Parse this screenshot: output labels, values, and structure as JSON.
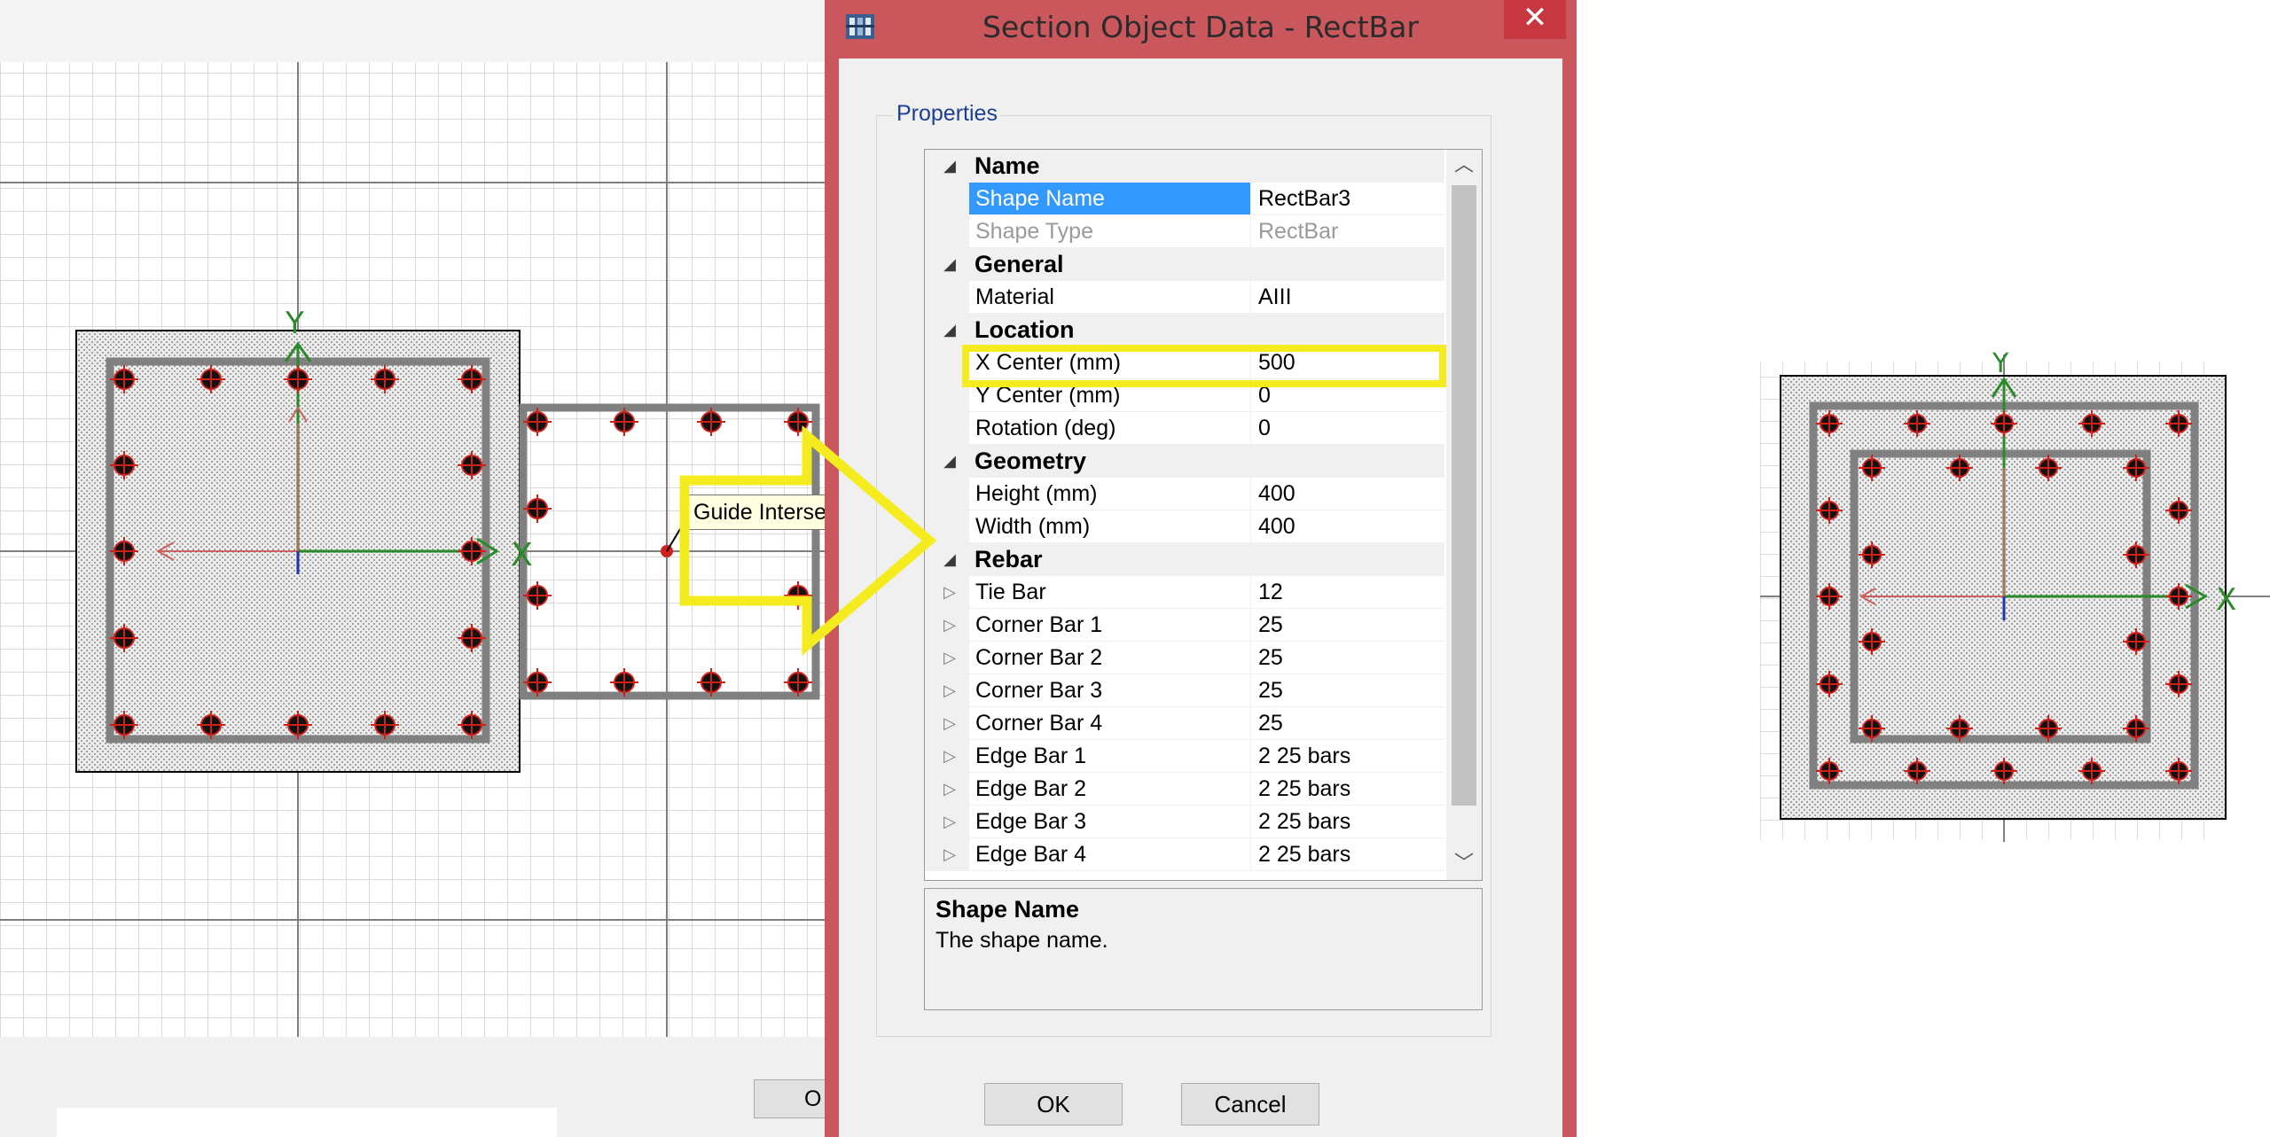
{
  "dialog": {
    "title": "Section Object Data - RectBar",
    "close_label": "✕",
    "group_label": "Properties",
    "categories": {
      "name": "Name",
      "general": "General",
      "location": "Location",
      "geometry": "Geometry",
      "rebar": "Rebar"
    },
    "properties": {
      "shape_name": {
        "label": "Shape Name",
        "value": "RectBar3"
      },
      "shape_type": {
        "label": "Shape Type",
        "value": "RectBar"
      },
      "material": {
        "label": "Material",
        "value": "AIII"
      },
      "x_center": {
        "label": "X Center (mm)",
        "value": "500"
      },
      "y_center": {
        "label": "Y Center (mm)",
        "value": "0"
      },
      "rotation": {
        "label": "Rotation (deg)",
        "value": "0"
      },
      "height": {
        "label": "Height (mm)",
        "value": "400"
      },
      "width": {
        "label": "Width (mm)",
        "value": "400"
      },
      "tie_bar": {
        "label": "Tie Bar",
        "value": "12"
      },
      "corner_bar_1": {
        "label": "Corner Bar 1",
        "value": "25"
      },
      "corner_bar_2": {
        "label": "Corner Bar 2",
        "value": "25"
      },
      "corner_bar_3": {
        "label": "Corner Bar 3",
        "value": "25"
      },
      "corner_bar_4": {
        "label": "Corner Bar 4",
        "value": "25"
      },
      "edge_bar_1": {
        "label": "Edge Bar 1",
        "value": "2 25 bars"
      },
      "edge_bar_2": {
        "label": "Edge Bar 2",
        "value": "2 25 bars"
      },
      "edge_bar_3": {
        "label": "Edge Bar 3",
        "value": "2 25 bars"
      },
      "edge_bar_4": {
        "label": "Edge Bar 4",
        "value": "2 25 bars"
      }
    },
    "description": {
      "title": "Shape Name",
      "text": "The shape name."
    },
    "ok_label": "OK",
    "cancel_label": "Cancel"
  },
  "left_canvas": {
    "tooltip": "Guide Intersection",
    "axis_x": "X",
    "axis_y": "Y",
    "ok_partial": "O"
  },
  "right_canvas": {
    "axis_x": "X",
    "axis_y": "Y"
  },
  "colors": {
    "dialog_border": "#c9575c",
    "close_button": "#c7373f",
    "selection": "#3399ff",
    "highlight": "#f5ec20",
    "axis_x": "#2a8a2a",
    "rebar": "#d0201a"
  },
  "icons": {
    "app": "etabs-app-icon",
    "close": "close-icon",
    "collapse": "triangle-down-icon",
    "expand": "triangle-right-icon"
  }
}
